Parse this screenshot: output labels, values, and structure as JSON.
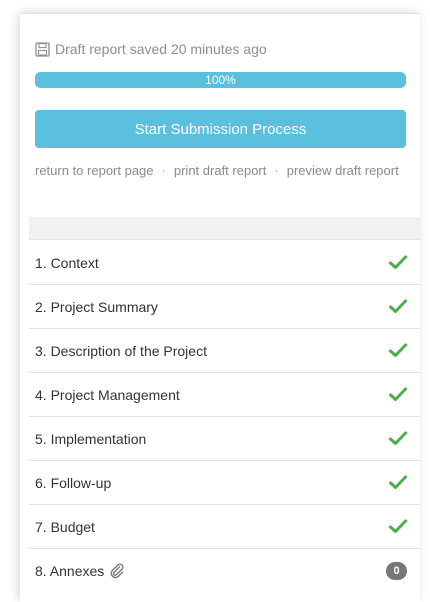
{
  "status": {
    "saved_text": "Draft report saved 20 minutes ago",
    "icon": "floppy-disk-icon"
  },
  "progress": {
    "percent": 100,
    "label": "100%",
    "color": "#5bc0de"
  },
  "submit": {
    "label": "Start Submission Process",
    "color": "#5bc0de"
  },
  "links": {
    "return": "return to report page",
    "print": "print draft report",
    "preview": "preview draft report",
    "separator": "·"
  },
  "sections": [
    {
      "label": "1. Context",
      "status": "complete",
      "icon": "check-icon"
    },
    {
      "label": "2. Project Summary",
      "status": "complete",
      "icon": "check-icon"
    },
    {
      "label": "3. Description of the Project",
      "status": "complete",
      "icon": "check-icon"
    },
    {
      "label": "4. Project Management",
      "status": "complete",
      "icon": "check-icon"
    },
    {
      "label": "5. Implementation",
      "status": "complete",
      "icon": "check-icon"
    },
    {
      "label": "6. Follow-up",
      "status": "complete",
      "icon": "check-icon"
    },
    {
      "label": "7. Budget",
      "status": "complete",
      "icon": "check-icon"
    },
    {
      "label": "8. Annexes",
      "status": "count",
      "icon": "paperclip-icon",
      "count": "0"
    }
  ],
  "colors": {
    "check": "#4cae4c",
    "badge": "#777777"
  }
}
